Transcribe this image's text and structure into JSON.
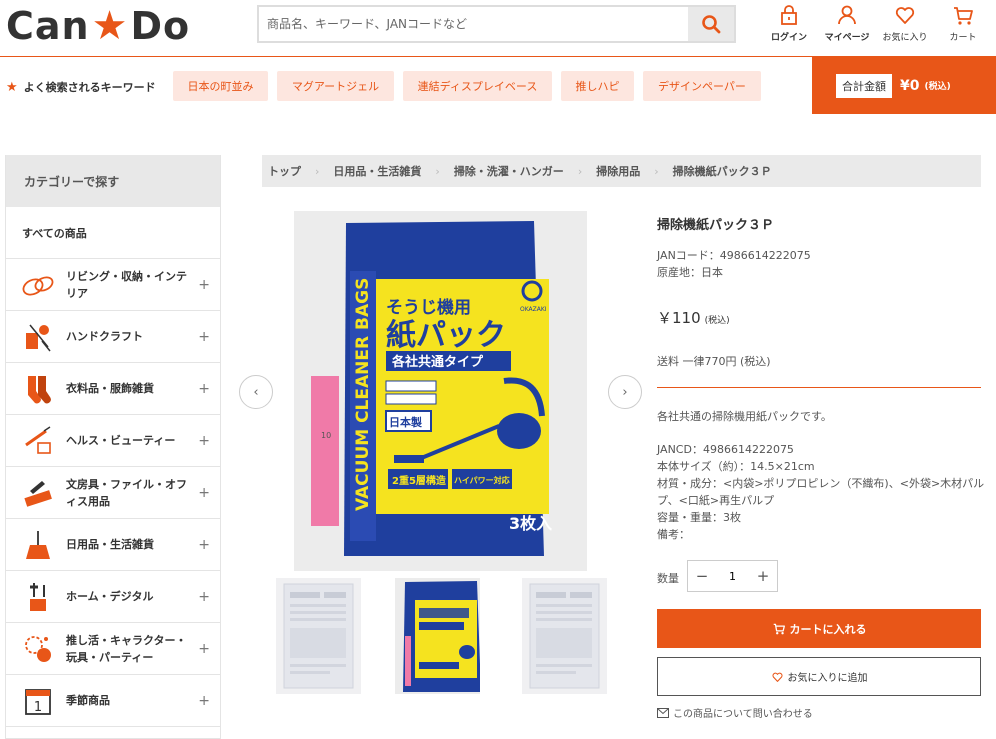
{
  "header": {
    "logo_left": "Can",
    "logo_right": "Do",
    "search_placeholder": "商品名、キーワード、JANコードなど",
    "icons": {
      "login": "ログイン",
      "mypage": "マイページ",
      "favorites": "お気に入り",
      "cart": "カート"
    }
  },
  "keywords": {
    "title": "よく検索されるキーワード",
    "items": [
      "日本の町並み",
      "マグアートジェル",
      "連結ディスプレイベース",
      "推しハピ",
      "デザインペーパー"
    ]
  },
  "total": {
    "label": "合計金額",
    "value": "¥0",
    "tax": "(税込)"
  },
  "sidebar": {
    "title": "カテゴリーで探す",
    "all": "すべての商品",
    "items": [
      {
        "label": "リビング・収納・インテリア",
        "icon": "living-icon"
      },
      {
        "label": "ハンドクラフト",
        "icon": "handcraft-icon"
      },
      {
        "label": "衣料品・服飾雑貨",
        "icon": "clothing-icon"
      },
      {
        "label": "ヘルス・ビューティー",
        "icon": "beauty-icon"
      },
      {
        "label": "文房具・ファイル・オフィス用品",
        "icon": "stationery-icon"
      },
      {
        "label": "日用品・生活雑貨",
        "icon": "broom-icon"
      },
      {
        "label": "ホーム・デジタル",
        "icon": "tools-icon"
      },
      {
        "label": "推し活・キャラクター・玩具・パーティー",
        "icon": "party-icon"
      },
      {
        "label": "季節商品",
        "icon": "calendar-icon"
      }
    ]
  },
  "breadcrumb": [
    "トップ",
    "日用品・生活雑貨",
    "掃除・洗濯・ハンガー",
    "掃除用品",
    "掃除機紙パック３Ｐ"
  ],
  "product": {
    "name": "掃除機紙パック３Ｐ",
    "jan": "JANコード：4986614222075",
    "origin": "原産地：日本",
    "price": "￥110",
    "price_tax": "(税込)",
    "shipping": "送料 一律770円 (税込)",
    "description": "各社共通の掃除機用紙パックです。",
    "specs": [
      "JANCD：4986614222075",
      "本体サイズ（約）：14.5×21cm",
      "材質・成分：<内袋>ポリプロピレン（不織布)、<外袋>木材パルプ、<口紙>再生パルプ",
      "容量・重量：3枚",
      "備考："
    ],
    "quantity_label": "数量",
    "quantity": "1",
    "cart_button": "カートに入れる",
    "fav_button": "お気に入りに追加",
    "inquiry": "この商品について問い合わせる"
  },
  "package_art": {
    "brand": "OKAZAKI",
    "title1": "そうじ機用",
    "title2": "紙パック",
    "subtitle": "各社共通タイプ",
    "side_text": "VACUUM CLEANER BAGS",
    "made_in": "日本製",
    "count": "3枚入",
    "feature1": "2重5層構造",
    "feature2": "ハイパワー対応"
  },
  "colors": {
    "accent": "#e85618",
    "chip_bg": "#fde6df",
    "package_blue": "#1f3f9e",
    "package_yellow": "#f5e31f"
  }
}
